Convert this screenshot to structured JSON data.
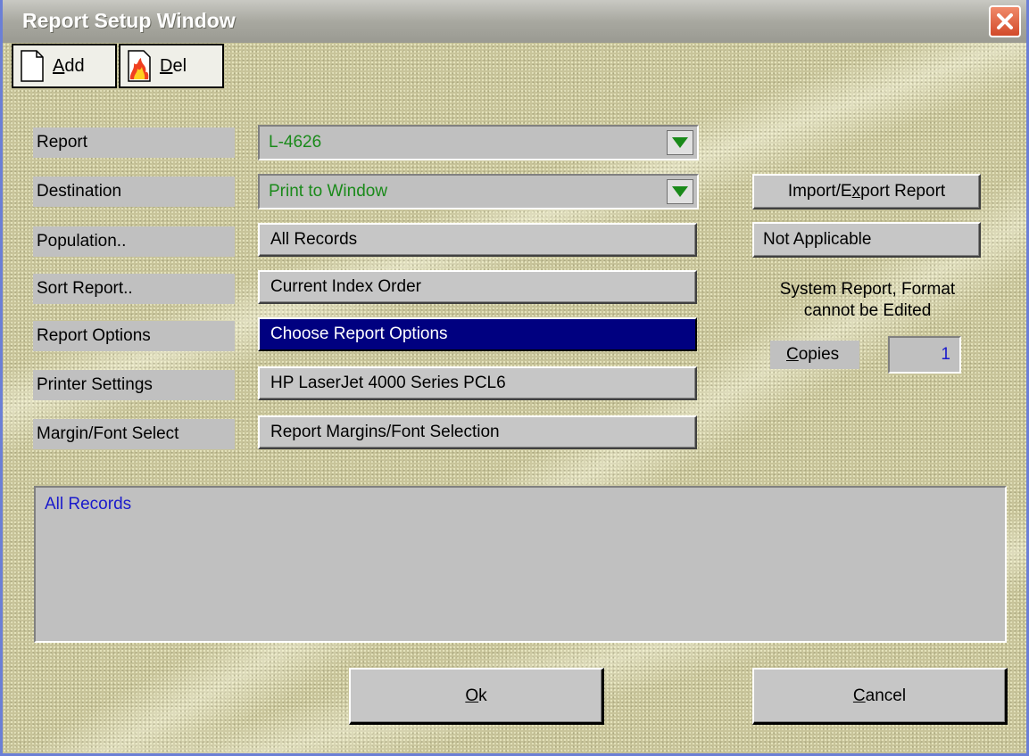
{
  "window": {
    "title": "Report Setup Window"
  },
  "toolbar": {
    "add_label_pre": "",
    "add_label_hot": "A",
    "add_label_post": "dd",
    "del_label_pre": "",
    "del_label_hot": "D",
    "del_label_post": "el"
  },
  "form": {
    "labels": {
      "report": "Report",
      "destination": "Destination",
      "population": "Population..",
      "sort": "Sort Report..",
      "options": "Report Options",
      "printer": "Printer Settings",
      "margin": "Margin/Font Select"
    },
    "values": {
      "report": "L-4626",
      "destination": "Print to Window",
      "population": "All Records",
      "sort": "Current Index Order",
      "options": "Choose Report Options",
      "printer": "HP LaserJet 4000 Series PCL6",
      "margin": "Report Margins/Font Selection"
    }
  },
  "side": {
    "import_pre": "Import/E",
    "import_hot": "x",
    "import_post": "port Report",
    "not_applicable": "Not Applicable",
    "info_line1": "System Report, Format",
    "info_line2": "cannot be Edited",
    "copies_hot": "C",
    "copies_post": "opies",
    "copies_value": "1"
  },
  "memo": {
    "text": "All Records"
  },
  "buttons": {
    "ok_hot": "O",
    "ok_post": "k",
    "cancel_hot": "C",
    "cancel_post": "ancel"
  },
  "colors": {
    "combo_text": "#1a8a1a",
    "selected_bg": "#000080",
    "memo_text": "#1a1acc"
  },
  "icons": {
    "close": "close-icon",
    "add": "new-document-icon",
    "del": "burning-document-icon",
    "dropdown": "dropdown-arrow-icon"
  }
}
